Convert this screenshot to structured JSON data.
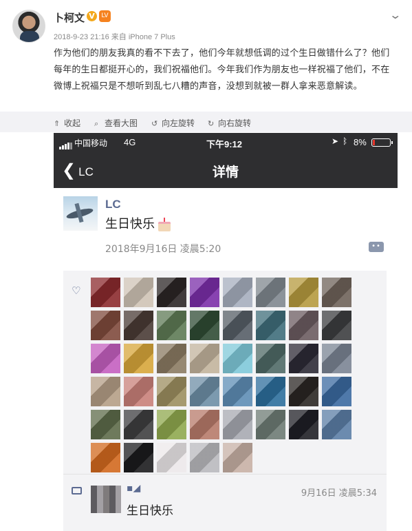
{
  "post": {
    "username": "卜柯文",
    "verified_badge": "V",
    "level_badge": "LV",
    "meta": "2018-9-23 21:16 来自 iPhone 7 Plus",
    "text": "作为他们的朋友我真的看不下去了，他们今年就想低调的过个生日做错什么了？他们每年的生日都挺开心的，我们祝福他们。今年我们作为朋友也一样祝福了他们，不在微博上祝福只是不想听到乱七八糟的声音，没想到就被一群人拿来恶意解读。",
    "menu_icon": "chevron-down-icon"
  },
  "actions": [
    {
      "label": "收起",
      "icon": "collapse-icon"
    },
    {
      "label": "查看大图",
      "icon": "zoom-icon"
    },
    {
      "label": "向左旋转",
      "icon": "rotate-left-icon"
    },
    {
      "label": "向右旋转",
      "icon": "rotate-right-icon"
    }
  ],
  "phone": {
    "status": {
      "carrier": "中国移动",
      "network": "4G",
      "time": "下午9:12",
      "battery": "8%"
    },
    "nav": {
      "back_label": "LC",
      "title": "详情"
    },
    "moment": {
      "name": "LC",
      "text": "生日快乐",
      "time": "2018年9月16日 凌晨5:20"
    },
    "likes_colors": [
      "#8b2a2e",
      "#cfc3b5",
      "#2b2526",
      "#7a2ea8",
      "#a6aebd",
      "#7f878e",
      "#b59a3e",
      "#6e6259",
      "#7f4a3c",
      "#4a3b35",
      "#5e7a55",
      "#2f4b34",
      "#565e66",
      "#3f6d7a",
      "#6b5b60",
      "#3c3d40",
      "#c45fbf",
      "#d7a63a",
      "#8a7a62",
      "#c2b39c",
      "#7fc9d9",
      "#4f6a66",
      "#2d2a36",
      "#7a8493",
      "#b49e86",
      "#c98079",
      "#9c8e5f",
      "#6d8ea6",
      "#5e8db5",
      "#2d6e9c",
      "#2a2623",
      "#3b6aa0",
      "#5d6b4a",
      "#3e3e40",
      "#8fa84e",
      "#b77a6a",
      "#a7a9b1",
      "#6d7b74",
      "#1f1f25",
      "#5b7ea6",
      "#d2691e",
      "#1b1b1d",
      "#ece8ea",
      "#b9b9bd",
      "#c7b0a5"
    ],
    "comment": {
      "name": "▪◢",
      "time": "9月16日 凌晨5:34",
      "text": "生日快乐"
    }
  }
}
